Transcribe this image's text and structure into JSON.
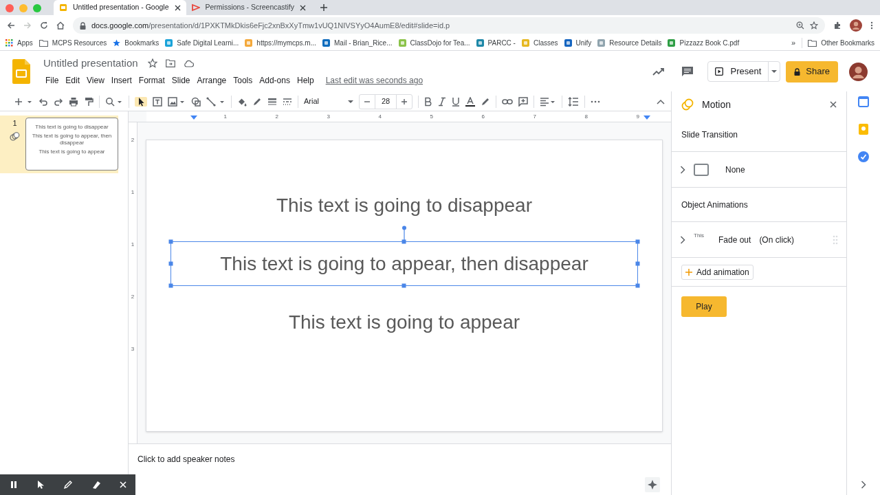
{
  "browser": {
    "tabs": [
      {
        "title": "Untitled presentation - Google",
        "selected": true
      },
      {
        "title": "Permissions - Screencastify",
        "selected": false
      }
    ],
    "url_host": "docs.google.com",
    "url_path": "/presentation/d/1PXKTMkDkis6eFjc2xnBxXyTmw1vUQ1NIVSYyO4AumE8/edit#slide=id.p",
    "bookmarks": [
      {
        "label": "Apps",
        "kind": "apps"
      },
      {
        "label": "MCPS Resources",
        "kind": "folder"
      },
      {
        "label": "Bookmarks",
        "kind": "star"
      },
      {
        "label": "Safe Digital Learni...",
        "kind": "site",
        "color": "#1aa3d9"
      },
      {
        "label": "https://mymcps.m...",
        "kind": "site",
        "color": "#f4a93b"
      },
      {
        "label": "Mail - Brian_Rice...",
        "kind": "site",
        "color": "#0f6cbd"
      },
      {
        "label": "ClassDojo for Tea...",
        "kind": "site",
        "color": "#8bc34a"
      },
      {
        "label": "PARCC -",
        "kind": "site",
        "color": "#1e88a8"
      },
      {
        "label": "Classes",
        "kind": "site",
        "color": "#e6b820"
      },
      {
        "label": "Unify",
        "kind": "site",
        "color": "#1565c0"
      },
      {
        "label": "Resource Details",
        "kind": "site",
        "color": "#90a4ae"
      },
      {
        "label": "Pizzazz Book C.pdf",
        "kind": "site",
        "color": "#2e9e44"
      }
    ],
    "more": "»",
    "other_bookmarks": "Other Bookmarks"
  },
  "app": {
    "title": "Untitled presentation",
    "menus": [
      "File",
      "Edit",
      "View",
      "Insert",
      "Format",
      "Slide",
      "Arrange",
      "Tools",
      "Add-ons",
      "Help"
    ],
    "last_edit": "Last edit was seconds ago",
    "present": "Present",
    "share": "Share"
  },
  "toolbar": {
    "font": "Arial",
    "font_size": "28"
  },
  "filmstrip": [
    {
      "number": "1",
      "selected": true,
      "texts": [
        "This text is going to disappear",
        "This text is going to appear, then disappear",
        "This text is going to appear"
      ]
    }
  ],
  "ruler": {
    "horizontal": [
      "1",
      "2",
      "3",
      "4",
      "5",
      "6",
      "7",
      "8",
      "9"
    ],
    "vertical": [
      "2",
      "1",
      "1",
      "2",
      "3"
    ]
  },
  "slide": {
    "text_boxes": [
      {
        "text": "This text is going to disappear",
        "selected": false
      },
      {
        "text": "This text is going to appear, then disappear",
        "selected": true
      },
      {
        "text": "This text is going to appear",
        "selected": false
      }
    ]
  },
  "speaker_notes": {
    "placeholder": "Click to add speaker notes"
  },
  "motion_panel": {
    "title": "Motion",
    "sections": [
      {
        "heading": "Slide Transition",
        "rows": [
          {
            "kind": "transition",
            "label": "None"
          }
        ]
      },
      {
        "heading": "Object Animations",
        "rows": [
          {
            "kind": "animation",
            "target": "This",
            "effect": "Fade out",
            "trigger": "(On click)"
          }
        ]
      }
    ],
    "add_animation": "Add animation",
    "play": "Play"
  }
}
